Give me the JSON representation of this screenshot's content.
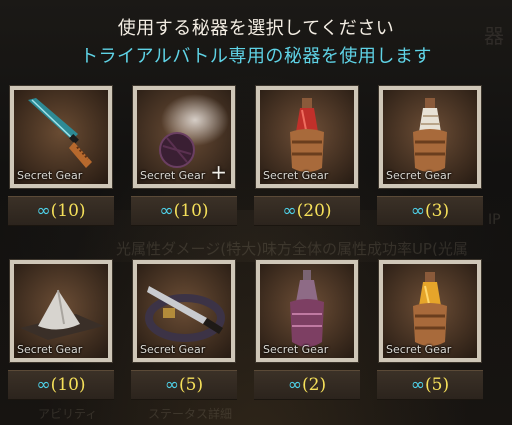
{
  "header": {
    "title": "使用する秘器を選択してください",
    "subtitle": "トライアルバトル専用の秘器を使用します"
  },
  "background": {
    "hint": "光属性ダメージ(特大)味方全体の属性成功率UP(光属",
    "right_num": "IP",
    "bottom_left": "アビリティ",
    "bottom_mid": "ステータス詳細",
    "corner": "器"
  },
  "colors": {
    "accent_cyan": "#5fd3e6",
    "count_yellow": "#f5e05a",
    "frame": "#cfc7b8"
  },
  "items": [
    {
      "caption": "Secret Gear",
      "infinity": "∞",
      "count": "(10)",
      "icon": "dagger-icon",
      "plus": ""
    },
    {
      "caption": "Secret Gear",
      "infinity": "∞",
      "count": "(10)",
      "icon": "smoke-bomb-icon",
      "plus": "+"
    },
    {
      "caption": "Secret Gear",
      "infinity": "∞",
      "count": "(20)",
      "icon": "red-potion-icon",
      "plus": ""
    },
    {
      "caption": "Secret Gear",
      "infinity": "∞",
      "count": "(3)",
      "icon": "white-potion-icon",
      "plus": ""
    },
    {
      "caption": "Secret Gear",
      "infinity": "∞",
      "count": "(10)",
      "icon": "powder-pile-icon",
      "plus": ""
    },
    {
      "caption": "Secret Gear",
      "infinity": "∞",
      "count": "(5)",
      "icon": "knife-belt-icon",
      "plus": ""
    },
    {
      "caption": "Secret Gear",
      "infinity": "∞",
      "count": "(2)",
      "icon": "purple-potion-icon",
      "plus": ""
    },
    {
      "caption": "Secret Gear",
      "infinity": "∞",
      "count": "(5)",
      "icon": "gold-potion-icon",
      "plus": ""
    }
  ]
}
